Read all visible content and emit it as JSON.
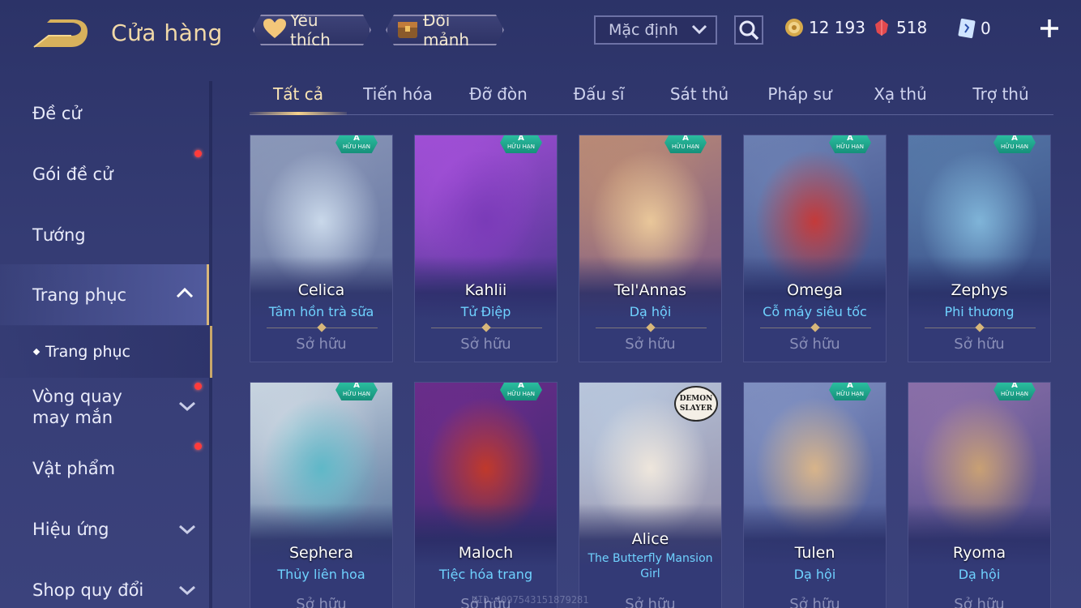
{
  "header": {
    "title": "Cửa hàng",
    "favorites_label": "Yêu thích",
    "fragments_label": "Đổi mảnh",
    "sort_value": "Mặc định",
    "gold_amount": "12 193",
    "gem_amount": "518",
    "voucher_amount": "0"
  },
  "sidebar": {
    "items": [
      {
        "label": "Đề cử"
      },
      {
        "label": "Gói đề cử"
      },
      {
        "label": "Tướng"
      },
      {
        "label": "Trang phục"
      },
      {
        "label": "Vòng quay may mắn"
      },
      {
        "label": "Vật phẩm"
      },
      {
        "label": "Hiệu ứng"
      },
      {
        "label": "Shop quy đổi"
      }
    ],
    "sub_item": "Trang phục"
  },
  "tabs": [
    {
      "label": "Tất cả"
    },
    {
      "label": "Tiến hóa"
    },
    {
      "label": "Đỡ đòn"
    },
    {
      "label": "Đấu sĩ"
    },
    {
      "label": "Sát thủ"
    },
    {
      "label": "Pháp sư"
    },
    {
      "label": "Xạ thủ"
    },
    {
      "label": "Trợ thủ"
    }
  ],
  "badge": {
    "rank": "A",
    "text": "HỮU HẠN"
  },
  "owned_label": "Sở hữu",
  "cards": [
    {
      "hero": "Celica",
      "skin": "Tâm hồn trà sữa",
      "colors": [
        "#c9d8ea",
        "#8a97b8",
        "#5b6a9a"
      ]
    },
    {
      "hero": "Kahlii",
      "skin": "Tử Điệp",
      "colors": [
        "#7a3bb8",
        "#a04fd6",
        "#3a2f7e"
      ]
    },
    {
      "hero": "Tel'Annas",
      "skin": "Dạ hội",
      "colors": [
        "#e9c79a",
        "#b98a76",
        "#6b4b8a"
      ]
    },
    {
      "hero": "Omega",
      "skin": "Cỗ máy siêu tốc",
      "colors": [
        "#c43a3a",
        "#6b7fb2",
        "#2f3d7a"
      ]
    },
    {
      "hero": "Zephys",
      "skin": "Phi thương",
      "colors": [
        "#7fb4d8",
        "#5678a8",
        "#2f3f7a"
      ]
    },
    {
      "hero": "Sephera",
      "skin": "Thủy liên hoa",
      "colors": [
        "#5fb8c8",
        "#c8d4e0",
        "#3a5a8a"
      ]
    },
    {
      "hero": "Maloch",
      "skin": "Tiệc hóa trang",
      "colors": [
        "#c0392b",
        "#6a2d8a",
        "#2e2a6a"
      ]
    },
    {
      "hero": "Alice",
      "skin": "The Butterfly Mansion Girl",
      "colors": [
        "#eee6dc",
        "#b8c6dc",
        "#8a7f9a"
      ]
    },
    {
      "hero": "Tulen",
      "skin": "Dạ hội",
      "colors": [
        "#d8b48a",
        "#7f8fc0",
        "#3e4a8a"
      ]
    },
    {
      "hero": "Ryoma",
      "skin": "Dạ hội",
      "colors": [
        "#c8a074",
        "#8a6fa8",
        "#3b4080"
      ]
    }
  ],
  "watermark": "UID:4097543151879281"
}
